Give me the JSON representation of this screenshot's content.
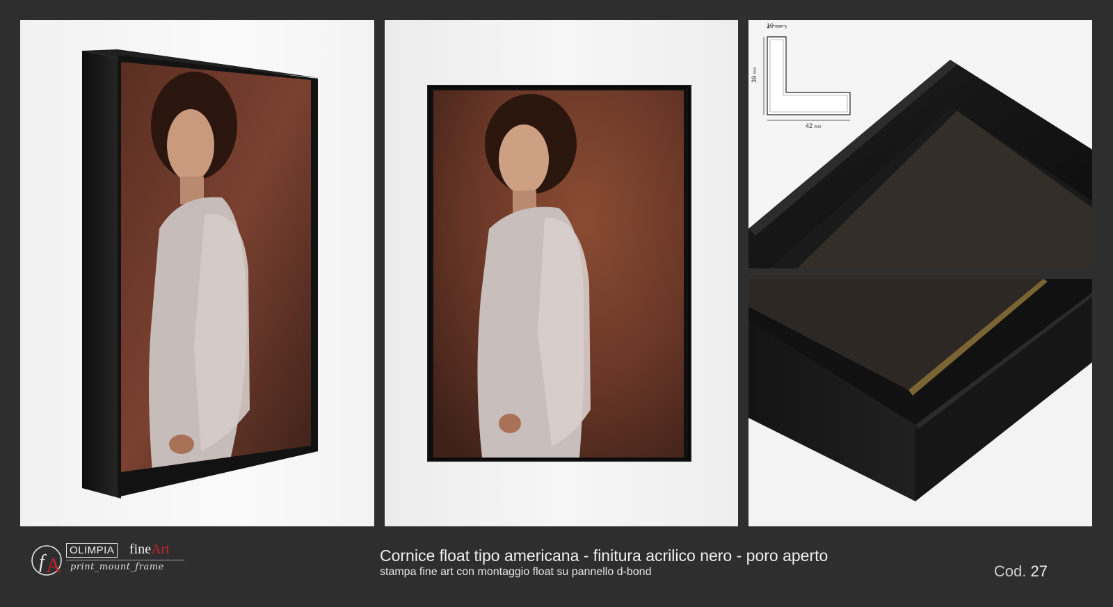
{
  "product": {
    "title": "Cornice float tipo americana - finitura acrilico nero - poro aperto",
    "subtitle": "stampa fine art con montaggio float su pannello d-bond",
    "code_label": "Cod.",
    "code_value": "27"
  },
  "brand": {
    "monogram": "fA",
    "name_box": "OLIMPIA",
    "name_fine": "fine",
    "name_art": "Art",
    "tagline": "print_mount_frame"
  },
  "profile_diagram": {
    "top_width": "10",
    "height": "39",
    "base_width": "42",
    "unit": "mm"
  },
  "colors": {
    "background": "#2e2e2e",
    "frame": "#151515",
    "brand_red": "#c8232c"
  }
}
